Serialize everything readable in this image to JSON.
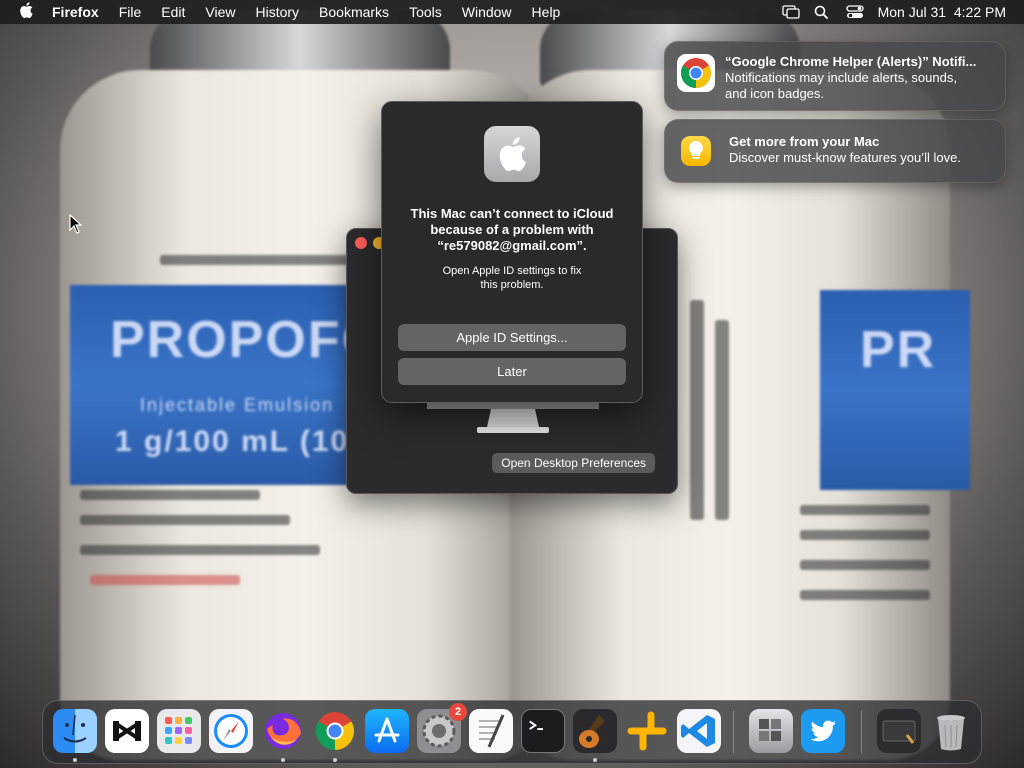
{
  "menubar": {
    "app_name": "Firefox",
    "items": [
      "File",
      "Edit",
      "View",
      "History",
      "Bookmarks",
      "Tools",
      "Window",
      "Help"
    ],
    "clock": "Mon Jul 31  4:22 PM"
  },
  "notifications": [
    {
      "title": "“Google Chrome Helper (Alerts)” Notifi...",
      "line1": "Notifications may include alerts, sounds,",
      "line2": "and icon badges.",
      "icon": "chrome-icon"
    },
    {
      "title": "Get more from your Mac",
      "line1": "Discover must-know features you’ll love.",
      "icon": "tips-lightbulb-icon"
    }
  ],
  "alert": {
    "heading_line1": "This Mac can’t connect to iCloud",
    "heading_line2": "because of a problem with",
    "heading_line3": "“re579082@gmail.com”.",
    "body_line1": "Open Apple ID settings to fix",
    "body_line2": "this problem.",
    "primary_button": "Apple ID Settings...",
    "secondary_button": "Later"
  },
  "desktop_window": {
    "button": "Open Desktop Preferences"
  },
  "dock": {
    "items": [
      {
        "name": "finder-icon",
        "running": true
      },
      {
        "name": "capcut-icon",
        "running": false
      },
      {
        "name": "launchpad-icon",
        "running": false
      },
      {
        "name": "safari-icon",
        "running": false
      },
      {
        "name": "firefox-icon",
        "running": true
      },
      {
        "name": "chrome-icon",
        "running": true
      },
      {
        "name": "app-store-icon",
        "running": false
      },
      {
        "name": "system-preferences-icon",
        "running": false,
        "badge": "2"
      },
      {
        "name": "textedit-icon",
        "running": false
      },
      {
        "name": "terminal-icon",
        "running": false
      },
      {
        "name": "garageband-icon",
        "running": true
      },
      {
        "name": "sublime-merge-icon",
        "running": false
      },
      {
        "name": "vscode-icon",
        "running": false
      },
      {
        "name": "boot-camp-icon",
        "running": false
      },
      {
        "name": "twitter-icon",
        "running": false
      },
      {
        "name": "screenshot-icon",
        "running": false
      },
      {
        "name": "trash-icon",
        "running": false
      }
    ]
  },
  "colors": {
    "menubar_bg": "#1e1e20",
    "alert_bg": "#2a2a2c",
    "button_bg": "#646466",
    "close_red": "#ff5f57",
    "minimize_yellow": "#febc2e"
  }
}
